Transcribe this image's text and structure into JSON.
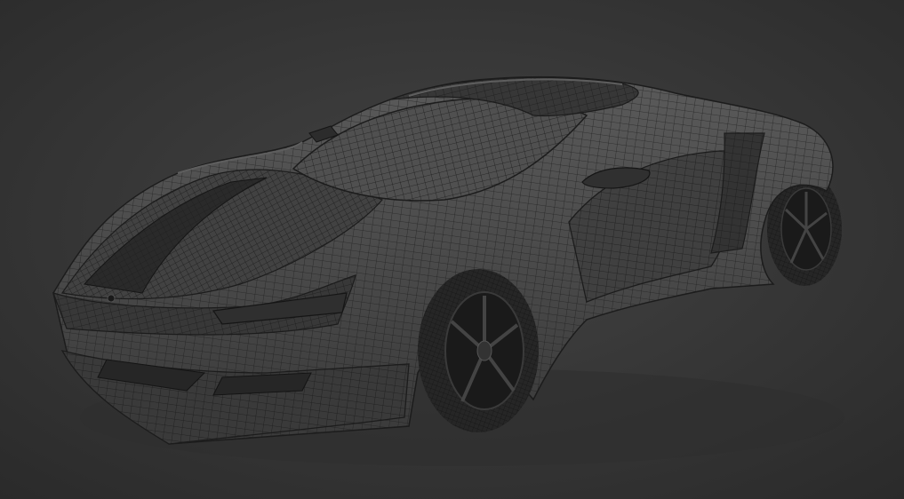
{
  "viewport": {
    "background_color": "#3c3c3c",
    "vignette_color": "#2a2a2a"
  },
  "model": {
    "subject": "sports-car",
    "shading": "wireframe-solid",
    "body_color": "#4a4a4a",
    "body_shadow_color": "#363636",
    "wire_color": "#1c1c1c",
    "tire_color": "#262626",
    "rim_color": "#1a1a1a",
    "highlight_color": "#5e5e5e"
  }
}
